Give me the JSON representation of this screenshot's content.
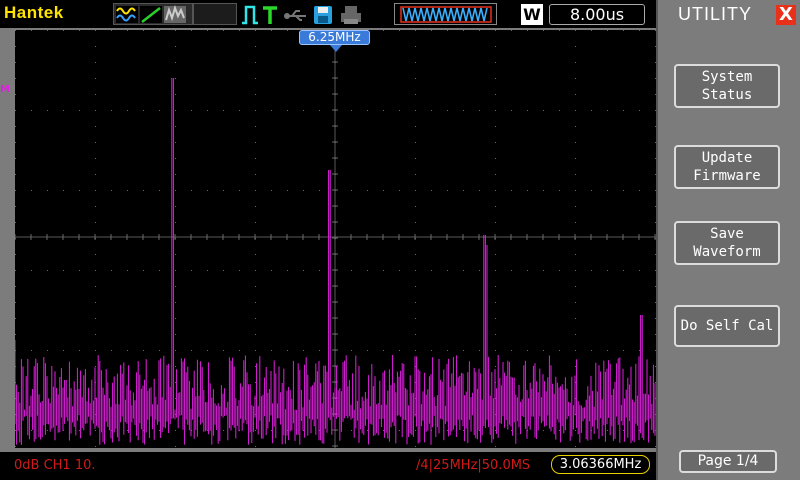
{
  "header": {
    "brand": "Hantek",
    "timebase": "8.00us",
    "w_badge": "W",
    "icons": [
      "wave-icon",
      "ramp-icon",
      "noise-icon",
      "pulse-icon",
      "trigger-t-icon",
      "usb-icon",
      "save-disk-icon",
      "printer-icon",
      "waveform-window-icon"
    ]
  },
  "screen": {
    "left_marker": "M",
    "freq_marker": "6.25MHz"
  },
  "status": {
    "left": "0dB  CH1  10.",
    "mid": "/4|25MHz|50.0MS",
    "readout": "3.06366MHz"
  },
  "panel": {
    "title": "UTILITY",
    "close": "X",
    "buttons": [
      {
        "line1": "System",
        "line2": "Status"
      },
      {
        "line1": "Update",
        "line2": "Firmware"
      },
      {
        "line1": "Save",
        "line2": "Waveform"
      },
      {
        "line1": "Do Self Cal",
        "line2": ""
      }
    ],
    "page": "Page 1/4"
  },
  "colors": {
    "trace": "#e020e0",
    "brand": "#ffe400",
    "accent": "#3a7ad8",
    "close": "#e8301a"
  }
}
